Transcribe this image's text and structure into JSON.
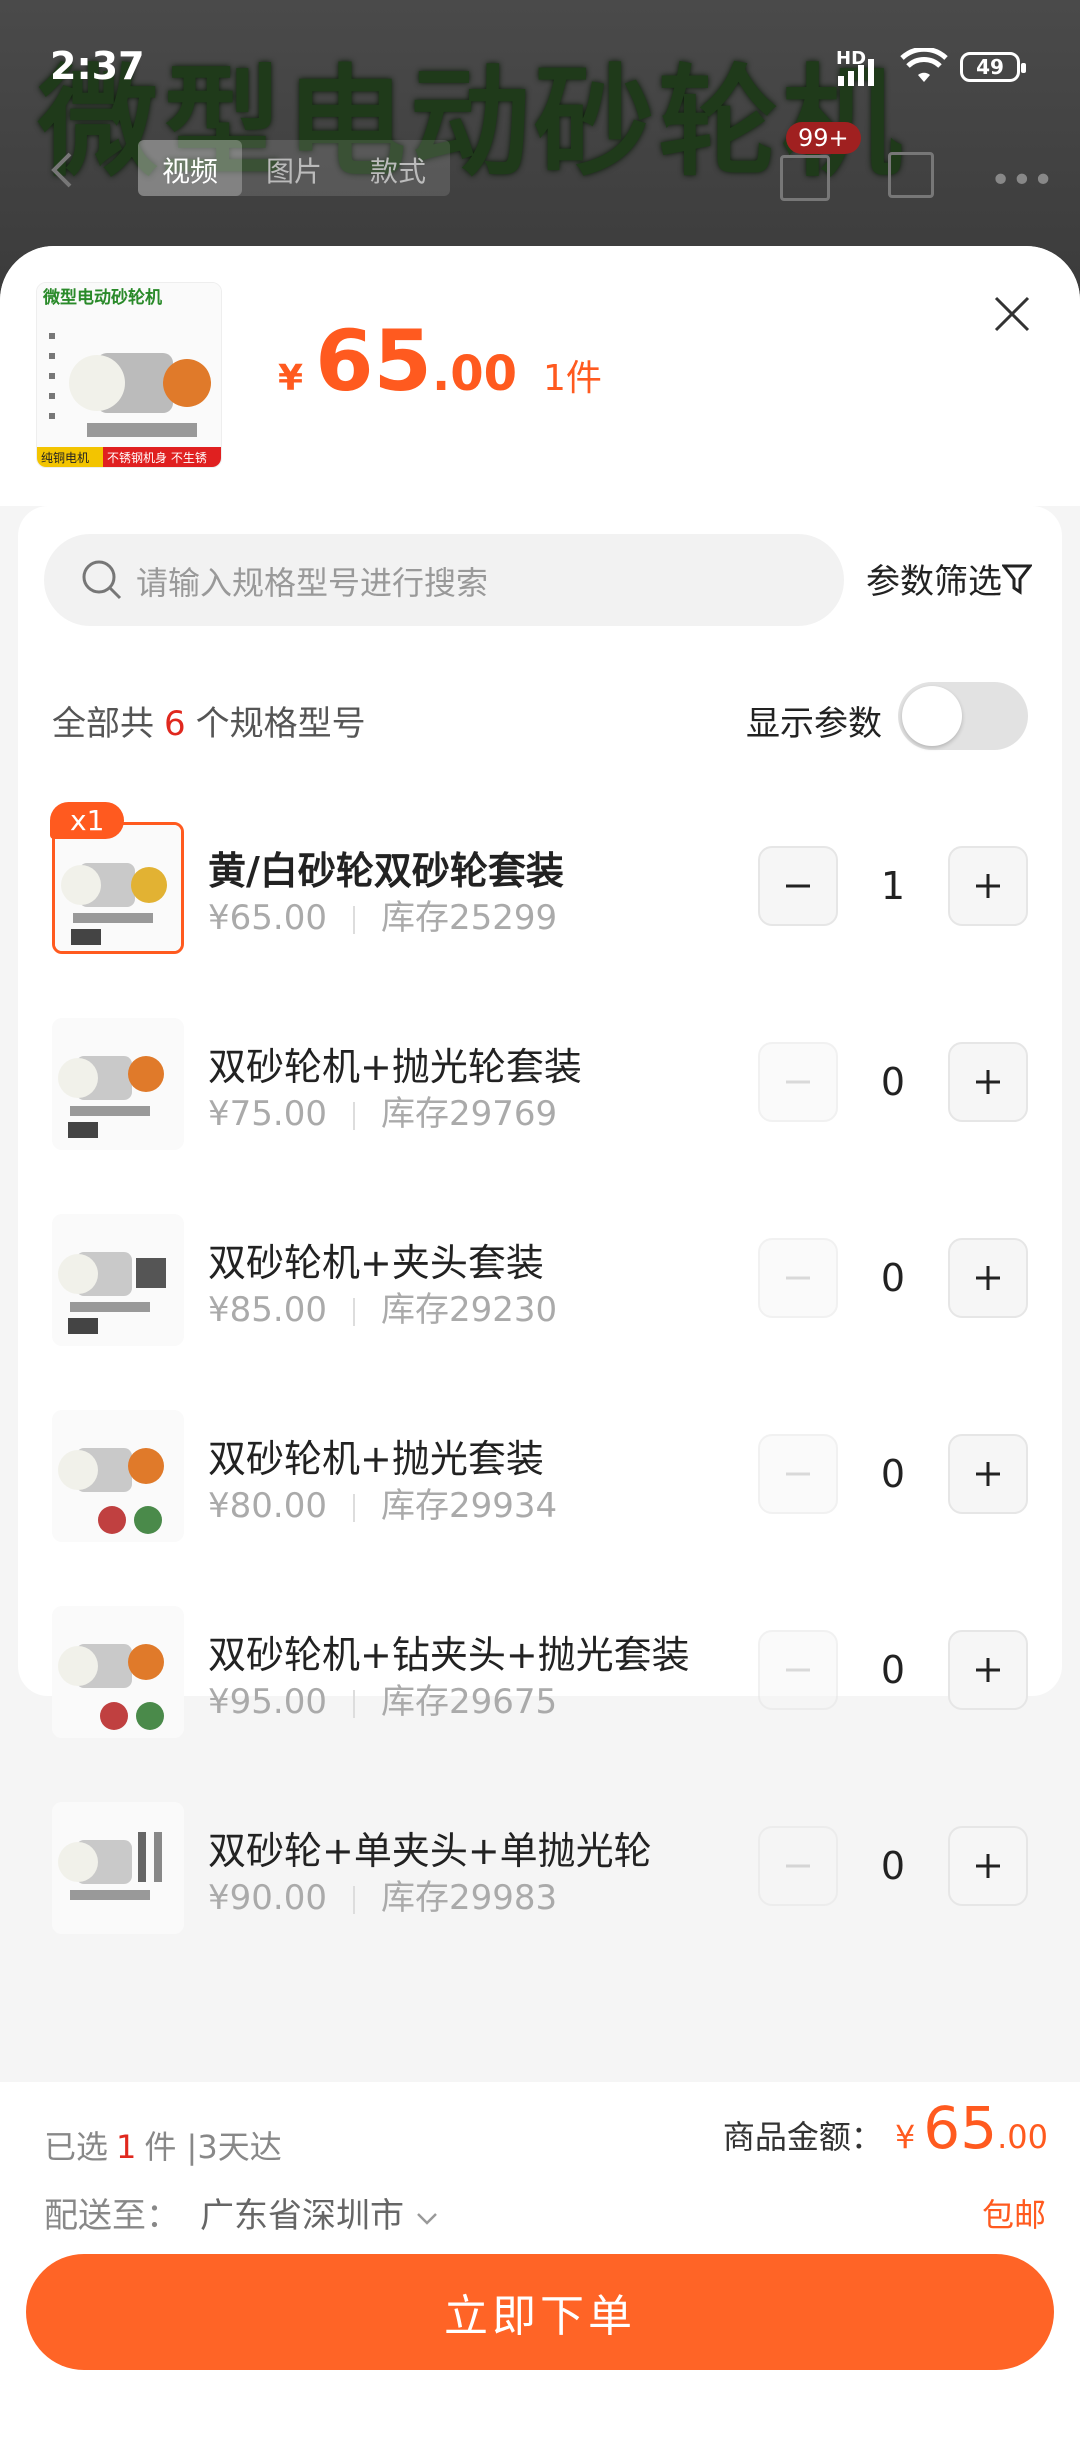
{
  "status_bar": {
    "time": "2:37",
    "network": "HD",
    "battery": "49"
  },
  "background": {
    "banner_text": "微型电动砂轮机",
    "tabs": [
      "视频",
      "图片",
      "款式"
    ],
    "active_tab": "视频",
    "cart_badge": "99+"
  },
  "header": {
    "currency": "¥",
    "price_int": "65",
    "price_dec": ".00",
    "qty_text": "1件",
    "thumb_title": "微型电动砂轮机",
    "thumb_tags": [
      "纯铜电机",
      "不锈钢机身 不生锈"
    ]
  },
  "search": {
    "placeholder": "请输入规格型号进行搜索",
    "filter_label": "参数筛选"
  },
  "spec_count": {
    "prefix": "全部共",
    "count": "6",
    "suffix": "个规格型号"
  },
  "show_params_label": "显示参数",
  "items": [
    {
      "name": "黄/白砂轮双砂轮套装",
      "price": "¥65.00",
      "stock": "库存25299",
      "qty": "1",
      "selected": true,
      "badge": "x1"
    },
    {
      "name": "双砂轮机+抛光轮套装",
      "price": "¥75.00",
      "stock": "库存29769",
      "qty": "0"
    },
    {
      "name": "双砂轮机+夹头套装",
      "price": "¥85.00",
      "stock": "库存29230",
      "qty": "0"
    },
    {
      "name": "双砂轮机+抛光套装",
      "price": "¥80.00",
      "stock": "库存29934",
      "qty": "0"
    },
    {
      "name": "双砂轮机+钻夹头+抛光套装",
      "price": "¥95.00",
      "stock": "库存29675",
      "qty": "0"
    },
    {
      "name": "双砂轮+单夹头+单抛光轮",
      "price": "¥90.00",
      "stock": "库存29983",
      "qty": "0"
    }
  ],
  "footer": {
    "selected_prefix": "已选",
    "selected_count": "1",
    "selected_suffix": "件 |3天达",
    "amount_label": "商品金额：",
    "amount_currency": "¥",
    "amount_int": "65",
    "amount_dec": ".00",
    "ship_label": "配送至：",
    "ship_addr": "广东省深圳市",
    "free_shipping": "包邮",
    "buy_label": "立即下单"
  },
  "colors": {
    "accent": "#ff5a1f",
    "button": "#ff6426",
    "count_red": "#e0281e"
  }
}
